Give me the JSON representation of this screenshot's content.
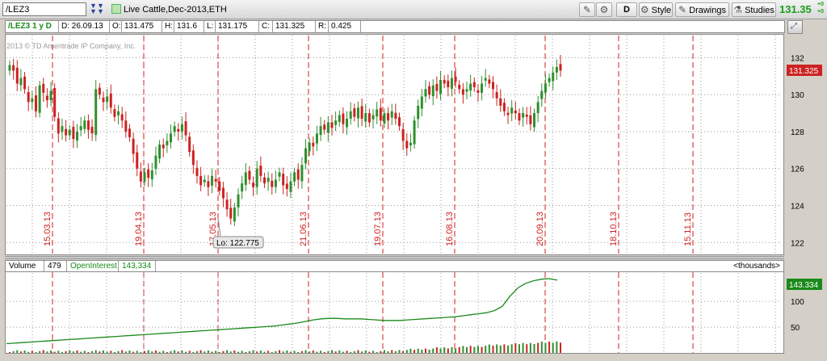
{
  "toolbar": {
    "symbol_value": "/LEZ3",
    "description": "Live Cattle,Dec-2013,ETH",
    "period_label": "D",
    "style_label": "Style",
    "drawings_label": "Drawings",
    "studies_label": "Studies",
    "last_price": "131.35",
    "change_top": "+0",
    "change_bot": "+0"
  },
  "infobar": {
    "title": "/LEZ3 1 y D",
    "d": "D: 26.09.13",
    "o_label": "O:",
    "o": "131.475",
    "h_label": "H:",
    "h": "131.6",
    "l_label": "L:",
    "l": "131.175",
    "c_label": "C:",
    "c": "131.325",
    "r_label": "R:",
    "r": "0.425"
  },
  "watermark": "2013 © TD Ameritrade IP Company, Inc.",
  "price_badge": "131.325",
  "oi_badge": "143.334",
  "low_label": "Lo: 122.775",
  "lower_header": {
    "volume_label": "Volume",
    "volume_value": "479",
    "oi_label": "OpenInterest",
    "oi_value": "143,334",
    "units": "<thousands>"
  },
  "colors": {
    "up": "#2f8f2f",
    "down": "#cc2222",
    "grid": "#9a9a9a",
    "expiry_line": "#d02020",
    "oi_line": "#1a8a1a",
    "badge_price": "#cc2222",
    "badge_oi": "#1a8a1a",
    "last_price": "#19a019"
  },
  "chart_data": [
    {
      "type": "candlestick",
      "title": "Live Cattle,Dec-2013,ETH",
      "ylim": [
        121.4,
        133.2
      ],
      "y_ticks": [
        122,
        124,
        126,
        128,
        130,
        132
      ],
      "y_tick_labels": [
        "122",
        "124",
        "126",
        "128",
        "130",
        "132"
      ],
      "vertical_markers": [
        "15.03.13",
        "19.04.13",
        "17.05.13",
        "21.06.13",
        "19.07.13",
        "16.08.13",
        "20.09.13",
        "18.10.13",
        "15.11.13"
      ],
      "marker_positions": [
        1,
        3,
        5,
        7,
        9,
        11,
        13,
        15,
        17
      ],
      "closes": [
        131.6,
        131.3,
        130.6,
        130.9,
        130.3,
        129.6,
        129.8,
        129.1,
        130.5,
        130.1,
        129.7,
        130.2,
        128.8,
        127.9,
        128.3,
        127.8,
        128.1,
        127.6,
        128.0,
        128.3,
        128.6,
        128.1,
        127.9,
        130.3,
        130.0,
        129.6,
        129.9,
        129.3,
        128.8,
        129.1,
        128.6,
        128.0,
        127.7,
        126.8,
        126.0,
        125.3,
        125.8,
        125.5,
        125.9,
        126.7,
        127.3,
        127.1,
        127.5,
        127.9,
        128.3,
        128.0,
        128.4,
        127.8,
        126.9,
        126.2,
        125.6,
        125.1,
        125.4,
        125.0,
        125.6,
        125.3,
        124.8,
        124.4,
        123.8,
        123.3,
        123.9,
        124.6,
        125.2,
        125.8,
        125.4,
        125.0,
        126.0,
        125.6,
        125.2,
        125.5,
        125.0,
        125.4,
        125.8,
        125.1,
        124.9,
        125.3,
        125.8,
        125.4,
        126.2,
        127.1,
        127.4,
        127.2,
        127.9,
        128.3,
        128.1,
        128.5,
        128.2,
        128.6,
        128.9,
        128.4,
        128.7,
        129.1,
        128.8,
        129.3,
        128.7,
        129.0,
        128.5,
        128.9,
        129.2,
        128.6,
        129.0,
        128.6,
        129.1,
        128.7,
        128.3,
        127.5,
        127.1,
        127.4,
        128.6,
        129.4,
        129.9,
        130.3,
        130.0,
        130.5,
        130.2,
        130.8,
        130.6,
        130.4,
        130.9,
        130.7,
        130.3,
        130.0,
        130.3,
        130.6,
        130.4,
        130.1,
        130.6,
        130.9,
        130.6,
        130.3,
        129.8,
        129.4,
        129.1,
        128.9,
        129.3,
        129.0,
        128.6,
        129.0,
        128.8,
        128.4,
        129.0,
        129.6,
        130.2,
        130.6,
        130.9,
        131.2,
        131.5,
        131.3
      ]
    },
    {
      "type": "line",
      "series": [
        {
          "name": "OpenInterest",
          "values": [
            18,
            19,
            20,
            21,
            22,
            23,
            24,
            25,
            26,
            27,
            28,
            29,
            30,
            31,
            32,
            33,
            34,
            35,
            36,
            37,
            38,
            39,
            40,
            41,
            42,
            43,
            44,
            45,
            46,
            47,
            48,
            49,
            50,
            51,
            52,
            54,
            56,
            58,
            61,
            64,
            66,
            67,
            67,
            66,
            66,
            66,
            65,
            64,
            63,
            63,
            63,
            64,
            65,
            66,
            67,
            68,
            69,
            70,
            72,
            74,
            76,
            78,
            82,
            90,
            110,
            126,
            135,
            140,
            143,
            144,
            141
          ]
        }
      ],
      "ylim": [
        0,
        155
      ],
      "y_ticks": [
        50,
        100
      ],
      "y_tick_labels": [
        "50",
        "100"
      ],
      "units": "<thousands>"
    }
  ]
}
